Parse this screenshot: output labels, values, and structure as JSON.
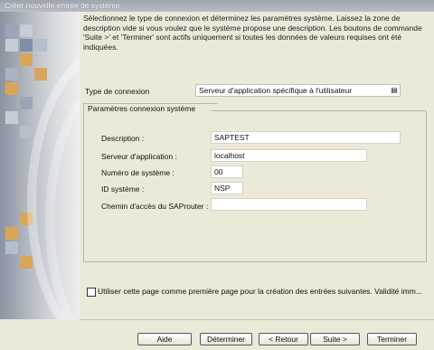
{
  "window": {
    "title": "Créer nouvelle entrée de système"
  },
  "intro": "Sélectionnez le type de connexion et déterminez les paramètres système. Laissez la zone de description vide si vous voulez que le système propose une description. Les boutons de commande 'Suite >' et 'Terminer' sont actifs uniquement si toutes les données de valeurs requises ont été indiquées.",
  "connection": {
    "label": "Type de connexion",
    "value": "Serveur d'application spécifique à l'utilisateur"
  },
  "group": {
    "title": "Paramètres connexion système",
    "fields": [
      {
        "label": "Description :",
        "value": "SAPTEST"
      },
      {
        "label": "Serveur d'application :",
        "value": "localhost"
      },
      {
        "label": "Numéro de système :",
        "value": "00"
      },
      {
        "label": "ID système :",
        "value": "NSP"
      },
      {
        "label": "Chemin d'accès du SAProuter :",
        "value": ""
      }
    ]
  },
  "checkbox": {
    "label": "Utiliser cette page comme première page pour la création des entrées suivantes. Validité imm...",
    "checked": false
  },
  "buttons": {
    "help": "Aide",
    "finish_defaults": "Déterminer",
    "back": "< Retour",
    "next": "Suite >",
    "finish": "Terminer"
  }
}
